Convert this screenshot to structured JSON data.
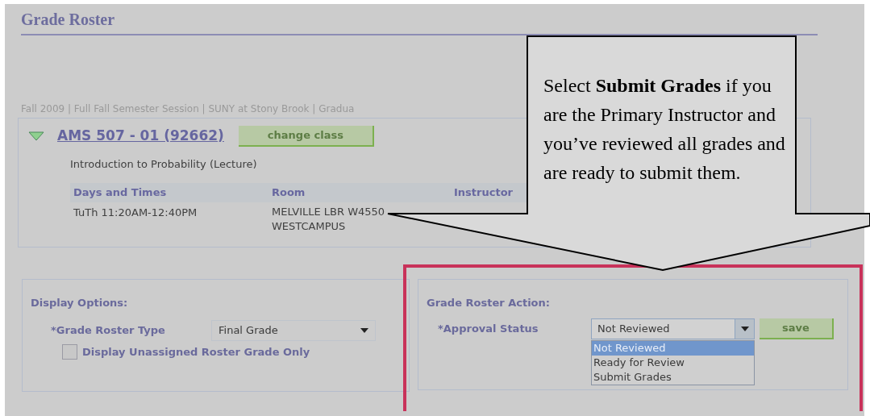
{
  "page": {
    "title": "Grade Roster"
  },
  "breadcrumb": "Fall 2009 | Full Fall Semester Session | SUNY at Stony Brook | Gradua",
  "class_section": {
    "expanded": true,
    "link": "AMS 507 - 01 (92662)",
    "change_button": "change class",
    "description": "Introduction to Probability (Lecture)",
    "columns": [
      "Days and Times",
      "Room",
      "Instructor"
    ],
    "rows": [
      {
        "days_and_times": "TuTh 11:20AM-12:40PM",
        "room_lines": [
          "MELVILLE LBR W4550",
          "WESTCAMPUS"
        ]
      }
    ]
  },
  "display_options": {
    "heading": "Display Options:",
    "roster_type_label": "*Grade Roster Type",
    "roster_type_value": "Final Grade",
    "unassigned_label": "Display Unassigned Roster Grade Only",
    "unassigned_checked": false
  },
  "roster_action": {
    "highlighted": true,
    "heading": "Grade Roster Action:",
    "status_label": "*Approval Status",
    "status_value": "Not Reviewed",
    "save_button": "save",
    "options": [
      {
        "label": "Not Reviewed",
        "selected": true
      },
      {
        "label": "Ready for Review",
        "selected": false
      },
      {
        "label": "Submit Grades",
        "selected": false
      }
    ]
  },
  "callout": {
    "text": "Select **Submit Grades** if you are the Primary Instructor and you’ve reviewed all grades and are ready to submit them."
  }
}
